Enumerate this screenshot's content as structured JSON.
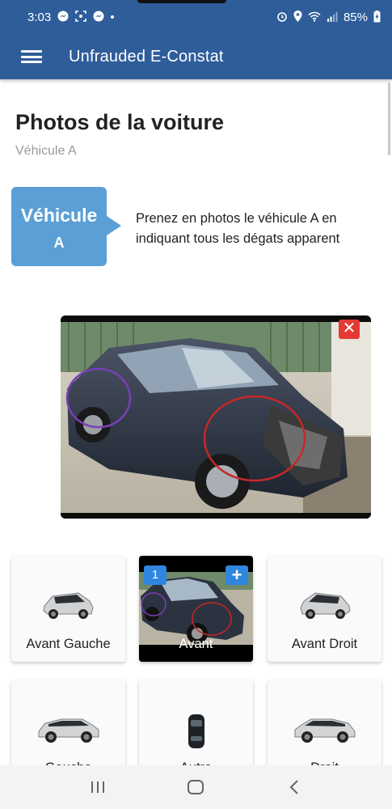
{
  "status_bar": {
    "time": "3:03",
    "battery": "85%"
  },
  "app_bar": {
    "title": "Unfrauded E-Constat",
    "menu_icon": "hamburger-menu-icon"
  },
  "page": {
    "title": "Photos de la voiture",
    "subtitle": "Véhicule A"
  },
  "bubble": {
    "title": "Véhicule",
    "letter": "A"
  },
  "instruction": "Prenez en photos le véhicule A en indiquant tous les dégats apparent",
  "main_photo": {
    "delete_label": "✕"
  },
  "tiles": [
    {
      "label": "Avant Gauche",
      "icon": "car-front-left-icon"
    },
    {
      "label": "Avant",
      "badge": "1",
      "add": "+",
      "icon": "car-photo-thumbnail"
    },
    {
      "label": "Avant Droit",
      "icon": "car-front-right-icon"
    },
    {
      "label": "Gauche",
      "icon": "car-left-side-icon"
    },
    {
      "label": "Autre",
      "icon": "car-top-view-icon"
    },
    {
      "label": "Droit",
      "icon": "car-right-side-icon"
    }
  ],
  "colors": {
    "primary": "#2f5d9a",
    "bubble": "#5b9fd6",
    "badge": "#2e86de",
    "delete": "#e53935"
  }
}
